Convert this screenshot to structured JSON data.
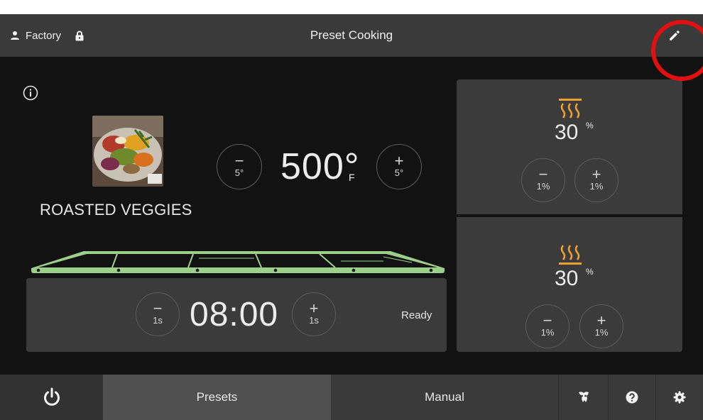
{
  "header": {
    "user_name": "Factory",
    "title": "Preset Cooking"
  },
  "recipe": {
    "name": "ROASTED VEGGIES"
  },
  "temperature": {
    "value": "500°",
    "unit": "F",
    "minus_sign": "−",
    "plus_sign": "+",
    "step_label": "5°"
  },
  "timer": {
    "value": "08:00",
    "minus_sign": "−",
    "plus_sign": "+",
    "step_label": "1s",
    "status": "Ready"
  },
  "top_heat": {
    "value": "30",
    "unit": "%",
    "minus_sign": "−",
    "plus_sign": "+",
    "step_label": "1%"
  },
  "bottom_heat": {
    "value": "30",
    "unit": "%",
    "minus_sign": "−",
    "plus_sign": "+",
    "step_label": "1%"
  },
  "footer": {
    "tabs": [
      {
        "label": "Presets",
        "active": true
      },
      {
        "label": "Manual",
        "active": false
      }
    ],
    "icons": [
      "power-icon",
      "clean-icon",
      "help-icon",
      "settings-icon"
    ]
  },
  "colors": {
    "background": "#121212",
    "panel": "#3b3b3b",
    "header": "#3a3a3a",
    "active_tab": "#505050",
    "conveyor_green": "#9ccf8a",
    "heat_orange": "#f0a030",
    "highlight_red": "#e01010"
  }
}
